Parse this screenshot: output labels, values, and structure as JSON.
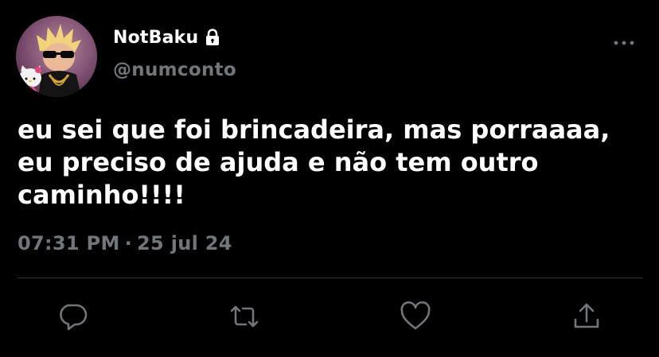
{
  "user": {
    "display_name": "NotBaku",
    "handle": "@numconto",
    "protected_icon": "lock-icon",
    "avatar_icon": "avatar"
  },
  "tweet": {
    "text": "eu sei que foi brincadeira, mas porraaaa,\neu preciso de ajuda e não tem outro\ncaminho!!!!",
    "time": "07:31 PM",
    "separator": "·",
    "date": "25 jul 24"
  },
  "actions": [
    {
      "name": "reply",
      "icon": "reply-icon"
    },
    {
      "name": "retweet",
      "icon": "retweet-icon"
    },
    {
      "name": "like",
      "icon": "heart-icon"
    },
    {
      "name": "share",
      "icon": "share-icon"
    }
  ],
  "colors": {
    "background": "#000000",
    "primary_text": "#ffffff",
    "secondary_text": "#71767b",
    "divider": "#2f3336",
    "icon": "#71767b"
  }
}
